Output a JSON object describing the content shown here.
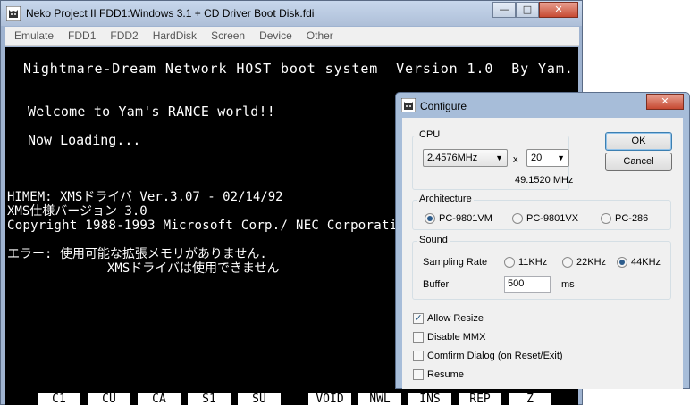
{
  "window": {
    "title": "Neko Project II  FDD1:Windows 3.1 + CD Driver Boot Disk.fdi",
    "minimize": "—",
    "maximize": "□",
    "close": "✕"
  },
  "menu": [
    "Emulate",
    "FDD1",
    "FDD2",
    "HardDisk",
    "Screen",
    "Device",
    "Other"
  ],
  "screen": {
    "lines": [
      "Nightmare-Dream Network HOST boot system  Version 1.0  By Yam.",
      "Welcome to Yam's RANCE world!!",
      "Now Loading...",
      "HIMEM: XMSドライバ Ver.3.07 - 02/14/92",
      "XMS仕様バージョン 3.0",
      "Copyright 1988-1993 Microsoft Corp./ NEC Corporation",
      "エラー: 使用可能な拡張メモリがありません.",
      "XMSドライバは使用できません"
    ],
    "function_keys": [
      "C1",
      "CU",
      "CA",
      "S1",
      "SU",
      "VOID",
      "NWL",
      "INS",
      "REP",
      "Z"
    ]
  },
  "dialog": {
    "title": "Configure",
    "close": "✕",
    "ok": "OK",
    "cancel": "Cancel",
    "cpu": {
      "label": "CPU",
      "clock": "2.4576MHz",
      "times": "x",
      "multiplier": "20",
      "result": "49.1520 MHz"
    },
    "architecture": {
      "label": "Architecture",
      "options": [
        "PC-9801VM",
        "PC-9801VX",
        "PC-286"
      ],
      "selected": "PC-9801VM"
    },
    "sound": {
      "label": "Sound",
      "sampling_label": "Sampling Rate",
      "rates": [
        "11KHz",
        "22KHz",
        "44KHz"
      ],
      "selected_rate": "44KHz",
      "buffer_label": "Buffer",
      "buffer_value": "500",
      "buffer_unit": "ms"
    },
    "options": [
      {
        "label": "Allow Resize",
        "checked": true
      },
      {
        "label": "Disable MMX",
        "checked": false
      },
      {
        "label": "Comfirm Dialog (on Reset/Exit)",
        "checked": false
      },
      {
        "label": "Resume",
        "checked": false
      }
    ]
  },
  "colors": {
    "screen_bg": "#000000",
    "screen_text": "#ffffff",
    "frame": "#a7bdd9",
    "close_button": "#c74a32"
  },
  "icons": {
    "app": "cat-app-icon"
  }
}
